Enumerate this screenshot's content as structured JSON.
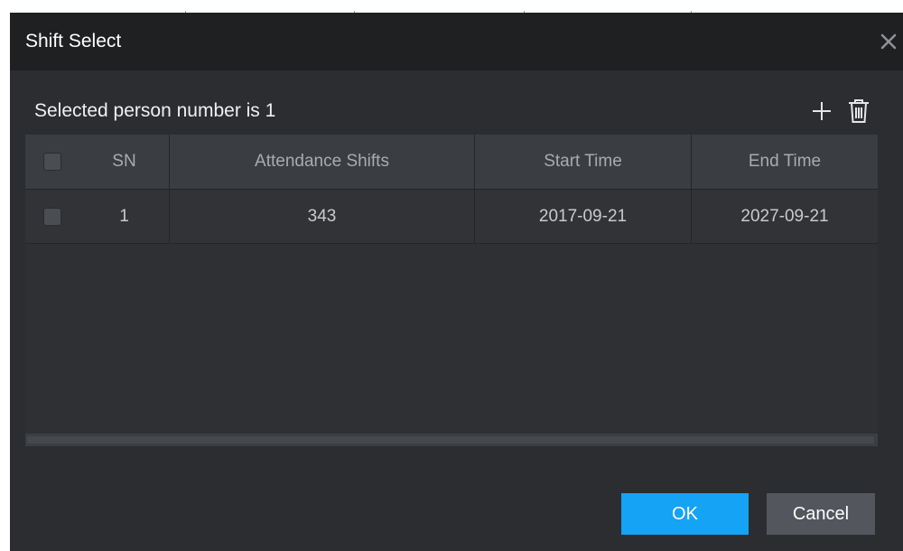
{
  "dialog": {
    "title": "Shift Select",
    "close_icon": "close-icon"
  },
  "selection": {
    "summary": "Selected person number is 1",
    "add_icon": "plus-icon",
    "delete_icon": "trash-icon"
  },
  "table": {
    "headers": {
      "sn": "SN",
      "shift": "Attendance Shifts",
      "start": "Start Time",
      "end": "End Time"
    },
    "rows": [
      {
        "sn": "1",
        "shift": "343",
        "start": "2017-09-21",
        "end": "2027-09-21",
        "checked": false
      }
    ],
    "select_all_checked": false
  },
  "buttons": {
    "ok": "OK",
    "cancel": "Cancel"
  },
  "colors": {
    "primary": "#14a3f5",
    "dialog_bg": "#2b2d31",
    "titlebar_bg": "#1f2022"
  }
}
